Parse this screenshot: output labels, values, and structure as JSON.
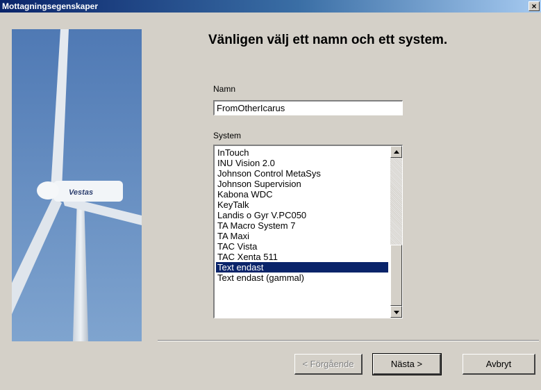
{
  "window": {
    "title": "Mottagningsegenskaper",
    "close_glyph": "×"
  },
  "wizard": {
    "heading": "Vänligen välj ett namn och ett system.",
    "name_label": "Namn",
    "name_value": "FromOtherIcarus",
    "system_label": "System",
    "system_items": [
      "InTouch",
      "INU Vision 2.0",
      "Johnson Control MetaSys",
      "Johnson Supervision",
      "Kabona WDC",
      "KeyTalk",
      "Landis o Gyr V.PC050",
      "TA Macro System 7",
      "TA Maxi",
      "TAC Vista",
      "TAC Xenta 511",
      "Text endast",
      "Text endast (gammal)"
    ],
    "selected_system": "Text endast"
  },
  "buttons": {
    "back": "< Förgående",
    "next": "Nästa >",
    "cancel": "Avbryt"
  },
  "colors": {
    "selection": "#0a246a",
    "dialog_bg": "#d4d0c8"
  },
  "icons": {
    "close": "close-icon",
    "scroll_up": "arrow-up-icon",
    "scroll_down": "arrow-down-icon"
  }
}
